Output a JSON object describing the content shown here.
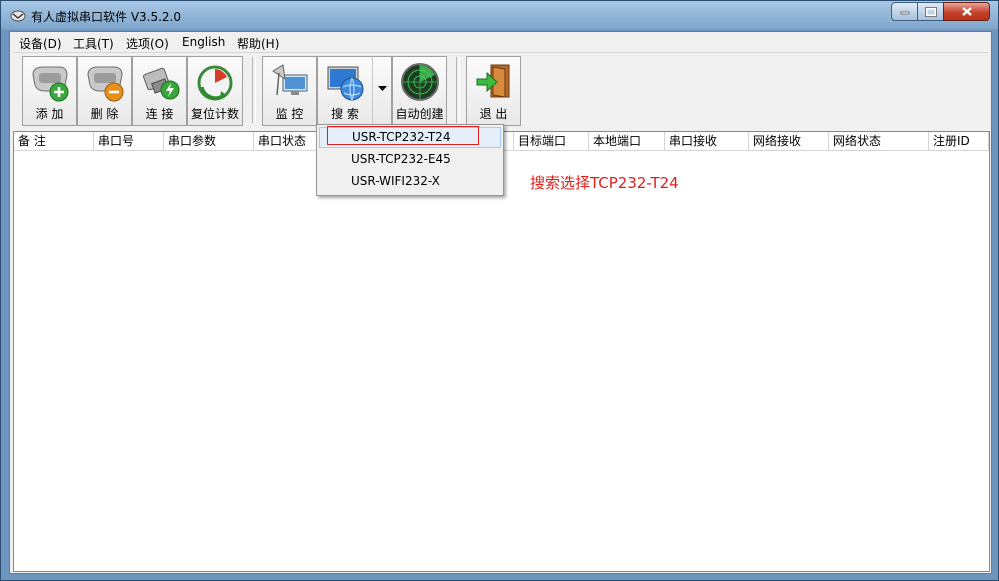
{
  "window": {
    "title": "有人虚拟串口软件 V3.5.2.0",
    "controls": {
      "minimize": "minimize",
      "maximize": "maximize",
      "close": "close"
    }
  },
  "menubar": {
    "items": [
      {
        "label": "设备(D)"
      },
      {
        "label": "工具(T)"
      },
      {
        "label": "选项(O)"
      },
      {
        "label": "English"
      },
      {
        "label": "帮助(H)"
      }
    ]
  },
  "toolbar": {
    "buttons": [
      {
        "label": "添 加",
        "icon": "add-port-icon"
      },
      {
        "label": "删 除",
        "icon": "delete-port-icon"
      },
      {
        "label": "连 接",
        "icon": "connect-icon"
      },
      {
        "label": "复位计数",
        "icon": "reset-count-icon"
      },
      {
        "label": "监 控",
        "icon": "monitor-icon"
      },
      {
        "label": "搜 索",
        "icon": "search-globe-icon"
      },
      {
        "label": "自动创建",
        "icon": "radar-icon"
      },
      {
        "label": "退 出",
        "icon": "exit-door-icon"
      }
    ]
  },
  "list": {
    "columns": [
      "备 注",
      "串口号",
      "串口参数",
      "串口状态",
      "",
      "",
      "目标端口",
      "本地端口",
      "串口接收",
      "网络接收",
      "网络状态",
      "注册ID"
    ]
  },
  "dropdown": {
    "items": [
      "USR-TCP232-T24",
      "USR-TCP232-E45",
      "USR-WIFI232-X"
    ],
    "selected_index": 0
  },
  "annotation": {
    "text": "搜索选择TCP232-T24",
    "color": "#e0201c"
  },
  "colors": {
    "titlebar": "#a9c8e6",
    "client": "#f0f0f0",
    "close": "#c4432c",
    "highlight_box": "#e02020"
  }
}
